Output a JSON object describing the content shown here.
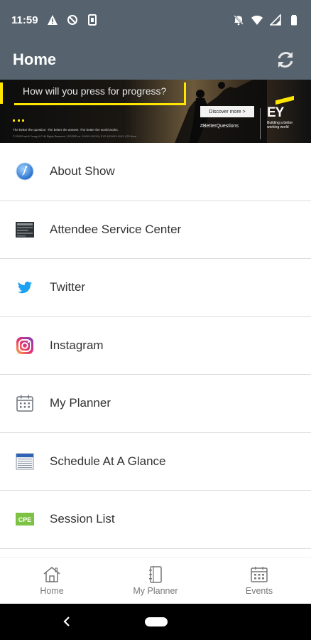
{
  "status_bar": {
    "time": "11:59",
    "icons_left": [
      "warning-icon",
      "no-sync-icon",
      "sim-icon"
    ],
    "icons_right": [
      "mute-icon",
      "wifi-icon",
      "signal-icon",
      "battery-icon"
    ]
  },
  "app_bar": {
    "title": "Home",
    "refresh_icon": "refresh-icon"
  },
  "banner": {
    "question": "How will you press for progress?",
    "tagline": "The better the question. The better the answer. The better the world works.",
    "fine_print": "© 2018 Ernst & Young LLP. All Rights Reserved.  |  SCORE no. XXXXX-XXXXX  |  EYG XXXXXX-XXXX  |  ED None",
    "cta": "Discover more >",
    "hashtag": "#BetterQuestions",
    "brand": "EY",
    "brand_sub": "Building a better working world"
  },
  "menu": {
    "items": [
      {
        "label": "About Show",
        "icon": "info-globe-icon"
      },
      {
        "label": "Attendee Service Center",
        "icon": "service-center-icon"
      },
      {
        "label": "Twitter",
        "icon": "twitter-icon"
      },
      {
        "label": "Instagram",
        "icon": "instagram-icon"
      },
      {
        "label": "My Planner",
        "icon": "calendar-grid-icon"
      },
      {
        "label": "Schedule At A Glance",
        "icon": "schedule-icon"
      },
      {
        "label": "Session List",
        "icon": "cpe-badge-icon",
        "badge_text": "CPE"
      }
    ]
  },
  "bottom_nav": {
    "items": [
      {
        "label": "Home",
        "icon": "home-icon"
      },
      {
        "label": "My Planner",
        "icon": "notebook-icon"
      },
      {
        "label": "Events",
        "icon": "calendar-icon"
      }
    ]
  },
  "colors": {
    "header": "#56636e",
    "banner_accent": "#ffe600",
    "twitter": "#1da1f2",
    "cpe_green": "#7dc242"
  }
}
